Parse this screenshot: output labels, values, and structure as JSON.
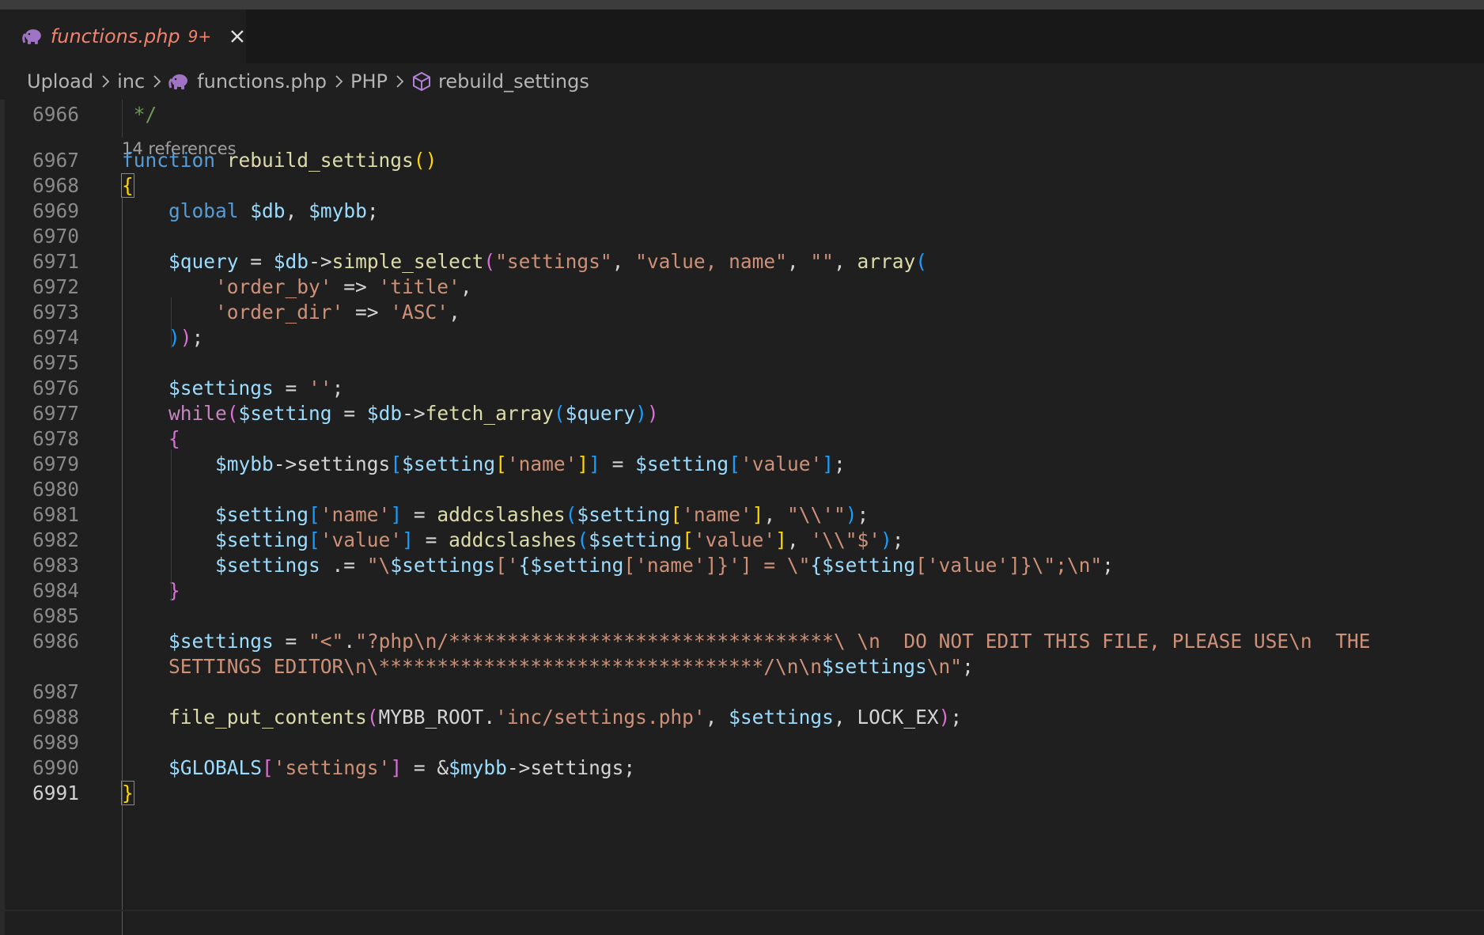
{
  "tab": {
    "filename": "functions.php",
    "problems": "9+"
  },
  "breadcrumb": [
    "Upload",
    "inc",
    "functions.php",
    "PHP",
    "rebuild_settings"
  ],
  "codelens": "14 references",
  "lines": [
    {
      "n": "6966",
      "t": " */"
    },
    {
      "n": "6967",
      "t": "function rebuild_settings()"
    },
    {
      "n": "6968",
      "t": "{"
    },
    {
      "n": "6969",
      "t": "    global $db, $mybb;"
    },
    {
      "n": "6970",
      "t": ""
    },
    {
      "n": "6971",
      "t": "    $query = $db->simple_select(\"settings\", \"value, name\", \"\", array("
    },
    {
      "n": "6972",
      "t": "        'order_by' => 'title',"
    },
    {
      "n": "6973",
      "t": "        'order_dir' => 'ASC',"
    },
    {
      "n": "6974",
      "t": "    ));"
    },
    {
      "n": "6975",
      "t": ""
    },
    {
      "n": "6976",
      "t": "    $settings = '';"
    },
    {
      "n": "6977",
      "t": "    while($setting = $db->fetch_array($query))"
    },
    {
      "n": "6978",
      "t": "    {"
    },
    {
      "n": "6979",
      "t": "        $mybb->settings[$setting['name']] = $setting['value'];"
    },
    {
      "n": "6980",
      "t": ""
    },
    {
      "n": "6981",
      "t": "        $setting['name'] = addcslashes($setting['name'], \"\\\\'\");"
    },
    {
      "n": "6982",
      "t": "        $setting['value'] = addcslashes($setting['value'], '\\\\\"$');"
    },
    {
      "n": "6983",
      "t": "        $settings .= \"\\$settings['{$setting['name']}'] = \\\"{$setting['value']}\\\";\\n\";"
    },
    {
      "n": "6984",
      "t": "    }"
    },
    {
      "n": "6985",
      "t": ""
    },
    {
      "n": "6986",
      "t": "    $settings = \"<\".\"?php\\n/*********************************\\ \\n  DO NOT EDIT THIS FILE, PLEASE USE\\n  THE"
    },
    {
      "n": "",
      "t": "    SETTINGS EDITOR\\n\\*********************************/\\n\\n$settings\\n\";"
    },
    {
      "n": "6987",
      "t": ""
    },
    {
      "n": "6988",
      "t": "    file_put_contents(MYBB_ROOT.'inc/settings.php', $settings, LOCK_EX);"
    },
    {
      "n": "6989",
      "t": ""
    },
    {
      "n": "6990",
      "t": "    $GLOBALS['settings'] = &$mybb->settings;"
    },
    {
      "n": "6991",
      "t": "}"
    }
  ]
}
